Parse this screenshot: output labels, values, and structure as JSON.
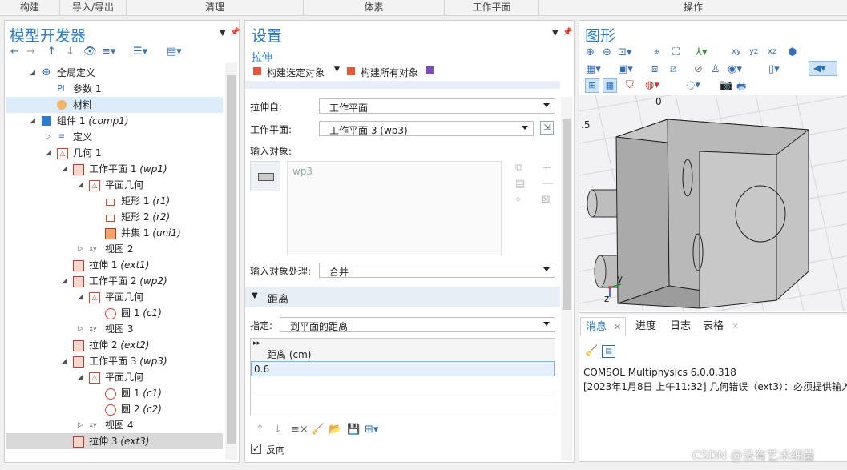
{
  "ribbon": {
    "groups": [
      "构建",
      "导入/导出",
      "清理",
      "体素",
      "工作平面",
      "操作"
    ]
  },
  "model_builder": {
    "title": "模型开发器",
    "tree": [
      {
        "label": "全局定义",
        "italic": "",
        "icon": "globe-icon"
      },
      {
        "label": "参数 1",
        "italic": "",
        "icon": "parameter-icon"
      },
      {
        "label": "材料",
        "italic": "",
        "icon": "material-icon"
      },
      {
        "label": "组件 1",
        "italic": "(comp1)",
        "icon": "component-icon"
      },
      {
        "label": "定义",
        "italic": "",
        "icon": "definitions-icon"
      },
      {
        "label": "几何 1",
        "italic": "",
        "icon": "geometry-icon"
      },
      {
        "label": "工作平面 1",
        "italic": "(wp1)",
        "icon": "work-plane-icon"
      },
      {
        "label": "平面几何",
        "italic": "",
        "icon": "plane-geometry-icon"
      },
      {
        "label": "矩形 1",
        "italic": "(r1)",
        "icon": "rectangle-icon"
      },
      {
        "label": "矩形 2",
        "italic": "(r2)",
        "icon": "rectangle-icon"
      },
      {
        "label": "并集 1",
        "italic": "(uni1)",
        "icon": "union-icon"
      },
      {
        "label": "视图 2",
        "italic": "",
        "icon": "view-icon"
      },
      {
        "label": "拉伸 1",
        "italic": "(ext1)",
        "icon": "extrude-icon"
      },
      {
        "label": "工作平面 2",
        "italic": "(wp2)",
        "icon": "work-plane-icon"
      },
      {
        "label": "平面几何",
        "italic": "",
        "icon": "plane-geometry-icon"
      },
      {
        "label": "圆 1",
        "italic": "(c1)",
        "icon": "circle-icon"
      },
      {
        "label": "视图 3",
        "italic": "",
        "icon": "view-icon"
      },
      {
        "label": "拉伸 2",
        "italic": "(ext2)",
        "icon": "extrude-icon"
      },
      {
        "label": "工作平面 3",
        "italic": "(wp3)",
        "icon": "work-plane-icon"
      },
      {
        "label": "平面几何",
        "italic": "",
        "icon": "plane-geometry-icon"
      },
      {
        "label": "圆 1",
        "italic": "(c1)",
        "icon": "circle-icon"
      },
      {
        "label": "圆 2",
        "italic": "(c2)",
        "icon": "circle-icon"
      },
      {
        "label": "视图 4",
        "italic": "",
        "icon": "view-icon"
      },
      {
        "label": "拉伸 3",
        "italic": "(ext3)",
        "icon": "extrude-icon"
      }
    ]
  },
  "settings": {
    "title": "设置",
    "subtitle": "拉伸",
    "build_selected": "构建选定对象",
    "build_all": "构建所有对象",
    "extrude_from_label": "拉伸自:",
    "extrude_from_value": "工作平面",
    "work_plane_label": "工作平面:",
    "work_plane_value": "工作平面 3 (wp3)",
    "input_objects_label": "输入对象:",
    "input_object_item": "wp3",
    "input_handling_label": "输入对象处理:",
    "input_handling_value": "合并",
    "distance_section": "距离",
    "specify_label": "指定:",
    "specify_value": "到平面的距离",
    "distance_header": "距离 (cm)",
    "distance_value": "0.6",
    "reverse_label": "反向"
  },
  "graphics": {
    "title": "图形",
    "axis_top": "0",
    "axis_left": ".5",
    "axis_y": "y",
    "axis_z": "z"
  },
  "messages": {
    "tabs": [
      "消息",
      "进度",
      "日志",
      "表格"
    ],
    "lines": [
      "COMSOL Multiphysics 6.0.0.318",
      "[2023年1月8日 上午11:32] 几何错误（ext3）：必须提供输入"
    ]
  },
  "watermark": "CSDN @没有艺术细菌",
  "colors": {
    "accent": "#2a7bc9",
    "selection": "#dcecfb",
    "current": "#d9d9d9"
  }
}
